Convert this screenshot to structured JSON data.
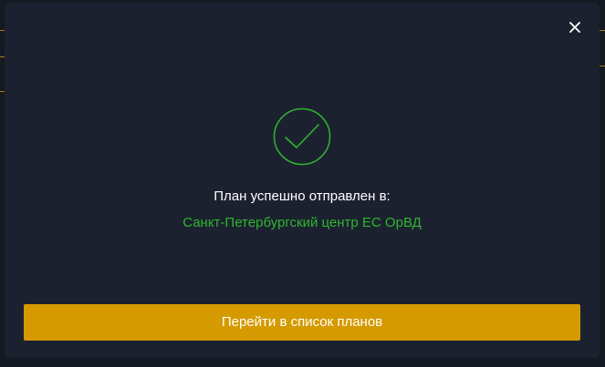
{
  "modal": {
    "title": "План успешно отправлен в:",
    "destination": "Санкт-Петербургский центр ЕС ОрВД",
    "primary_button": "Перейти в список планов",
    "close_icon": "close-icon",
    "status_icon": "check-circle-icon"
  },
  "colors": {
    "modal_bg": "#1c2130",
    "accent": "#d49a00",
    "success": "#2fb52f"
  }
}
